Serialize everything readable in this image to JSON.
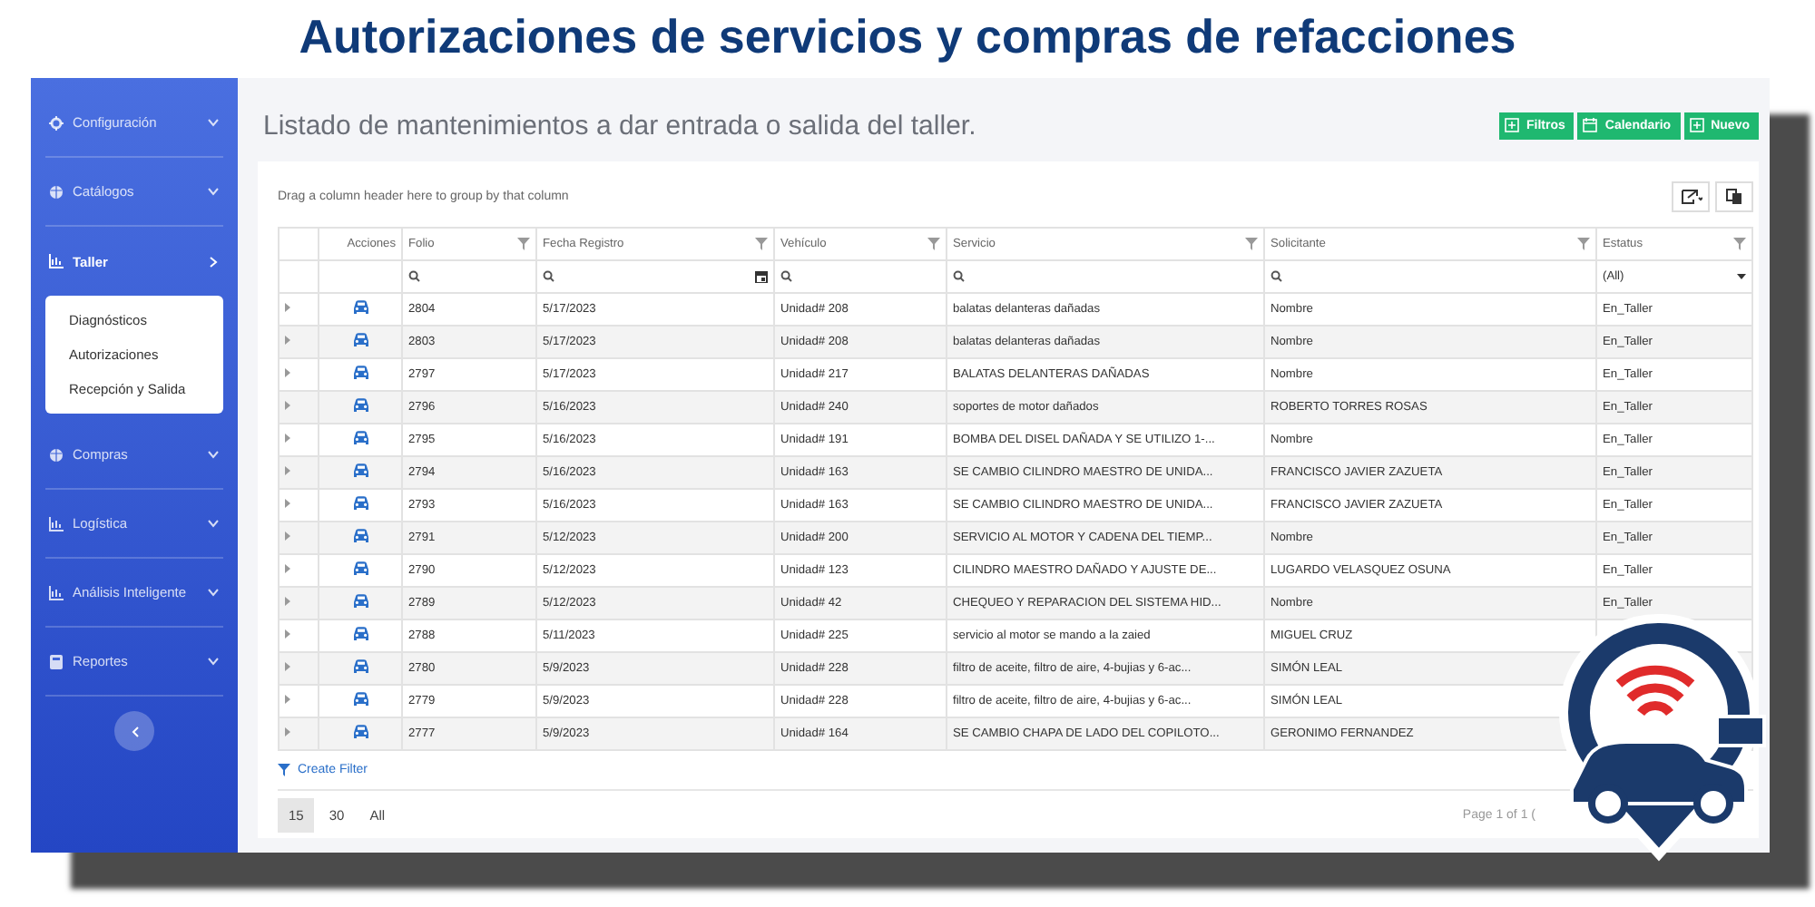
{
  "banner_title": "Autorizaciones de servicios y compras de refacciones",
  "sidebar": {
    "items": [
      {
        "label": "Configuración",
        "selected": false,
        "expanded": false
      },
      {
        "label": "Catálogos",
        "selected": false,
        "expanded": false
      },
      {
        "label": "Taller",
        "selected": true,
        "expanded": true,
        "children": [
          {
            "label": "Diagnósticos"
          },
          {
            "label": "Autorizaciones"
          },
          {
            "label": "Recepción y Salida"
          }
        ]
      },
      {
        "label": "Compras",
        "selected": false,
        "expanded": false
      },
      {
        "label": "Logística",
        "selected": false,
        "expanded": false
      },
      {
        "label": "Análisis Inteligente",
        "selected": false,
        "expanded": false
      },
      {
        "label": "Reportes",
        "selected": false,
        "expanded": false
      }
    ]
  },
  "page_title": "Listado de mantenimientos a dar entrada o salida del taller.",
  "buttons": [
    "Filtros",
    "Calendario",
    "Nuevo"
  ],
  "group_hint": "Drag a column header here to group by that column",
  "table": {
    "columns": [
      "Acciones",
      "Folio",
      "Fecha Registro",
      "Vehículo",
      "Servicio",
      "Solicitante",
      "Estatus"
    ],
    "status_filter": "(All)",
    "rows": [
      {
        "folio": "2804",
        "fecha": "5/17/2023",
        "vehiculo": "Unidad# 208",
        "servicio": "balatas delanteras dañadas",
        "solicitante": "Nombre",
        "estatus": "En_Taller"
      },
      {
        "folio": "2803",
        "fecha": "5/17/2023",
        "vehiculo": "Unidad# 208",
        "servicio": "balatas delanteras dañadas",
        "solicitante": "Nombre",
        "estatus": "En_Taller"
      },
      {
        "folio": "2797",
        "fecha": "5/17/2023",
        "vehiculo": "Unidad# 217",
        "servicio": "BALATAS DELANTERAS DAÑADAS",
        "solicitante": "Nombre",
        "estatus": "En_Taller"
      },
      {
        "folio": "2796",
        "fecha": "5/16/2023",
        "vehiculo": "Unidad# 240",
        "servicio": "soportes de motor dañados",
        "solicitante": "ROBERTO TORRES ROSAS",
        "estatus": "En_Taller"
      },
      {
        "folio": "2795",
        "fecha": "5/16/2023",
        "vehiculo": "Unidad# 191",
        "servicio": "BOMBA DEL DISEL DAÑADA Y SE UTILIZO 1-...",
        "solicitante": "Nombre",
        "estatus": "En_Taller"
      },
      {
        "folio": "2794",
        "fecha": "5/16/2023",
        "vehiculo": "Unidad# 163",
        "servicio": "SE CAMBIO CILINDRO MAESTRO DE UNIDA...",
        "solicitante": "FRANCISCO JAVIER ZAZUETA",
        "estatus": "En_Taller"
      },
      {
        "folio": "2793",
        "fecha": "5/16/2023",
        "vehiculo": "Unidad# 163",
        "servicio": "SE CAMBIO CILINDRO MAESTRO DE UNIDA...",
        "solicitante": "FRANCISCO JAVIER ZAZUETA",
        "estatus": "En_Taller"
      },
      {
        "folio": "2791",
        "fecha": "5/12/2023",
        "vehiculo": "Unidad# 200",
        "servicio": "SERVICIO AL MOTOR Y CADENA DEL TIEMP...",
        "solicitante": "Nombre",
        "estatus": "En_Taller"
      },
      {
        "folio": "2790",
        "fecha": "5/12/2023",
        "vehiculo": "Unidad# 123",
        "servicio": "CILINDRO MAESTRO DAÑADO Y AJUSTE DE...",
        "solicitante": "LUGARDO VELASQUEZ OSUNA",
        "estatus": "En_Taller"
      },
      {
        "folio": "2789",
        "fecha": "5/12/2023",
        "vehiculo": "Unidad# 42",
        "servicio": "CHEQUEO Y REPARACION DEL SISTEMA HID...",
        "solicitante": "Nombre",
        "estatus": "En_Taller"
      },
      {
        "folio": "2788",
        "fecha": "5/11/2023",
        "vehiculo": "Unidad# 225",
        "servicio": "servicio al motor se mando a la zaied",
        "solicitante": "MIGUEL CRUZ"
      },
      {
        "folio": "2780",
        "fecha": "5/9/2023",
        "vehiculo": "Unidad# 228",
        "servicio": "filtro de aceite, filtro de aire, 4-bujias y 6-ac...",
        "solicitante": "SIMÓN LEAL"
      },
      {
        "folio": "2779",
        "fecha": "5/9/2023",
        "vehiculo": "Unidad# 228",
        "servicio": "filtro de aceite, filtro de aire, 4-bujias y 6-ac...",
        "solicitante": "SIMÓN LEAL"
      },
      {
        "folio": "2777",
        "fecha": "5/9/2023",
        "vehiculo": "Unidad# 164",
        "servicio": "SE CAMBIO CHAPA DE LADO DEL COPILOTO...",
        "solicitante": "GERONIMO FERNANDEZ"
      }
    ]
  },
  "create_filter": "Create Filter",
  "pager": {
    "sizes": [
      {
        "label": "15",
        "selected": true
      },
      {
        "label": "30",
        "selected": false
      },
      {
        "label": "All",
        "selected": false
      }
    ],
    "info": "Page 1 of 1 ("
  }
}
